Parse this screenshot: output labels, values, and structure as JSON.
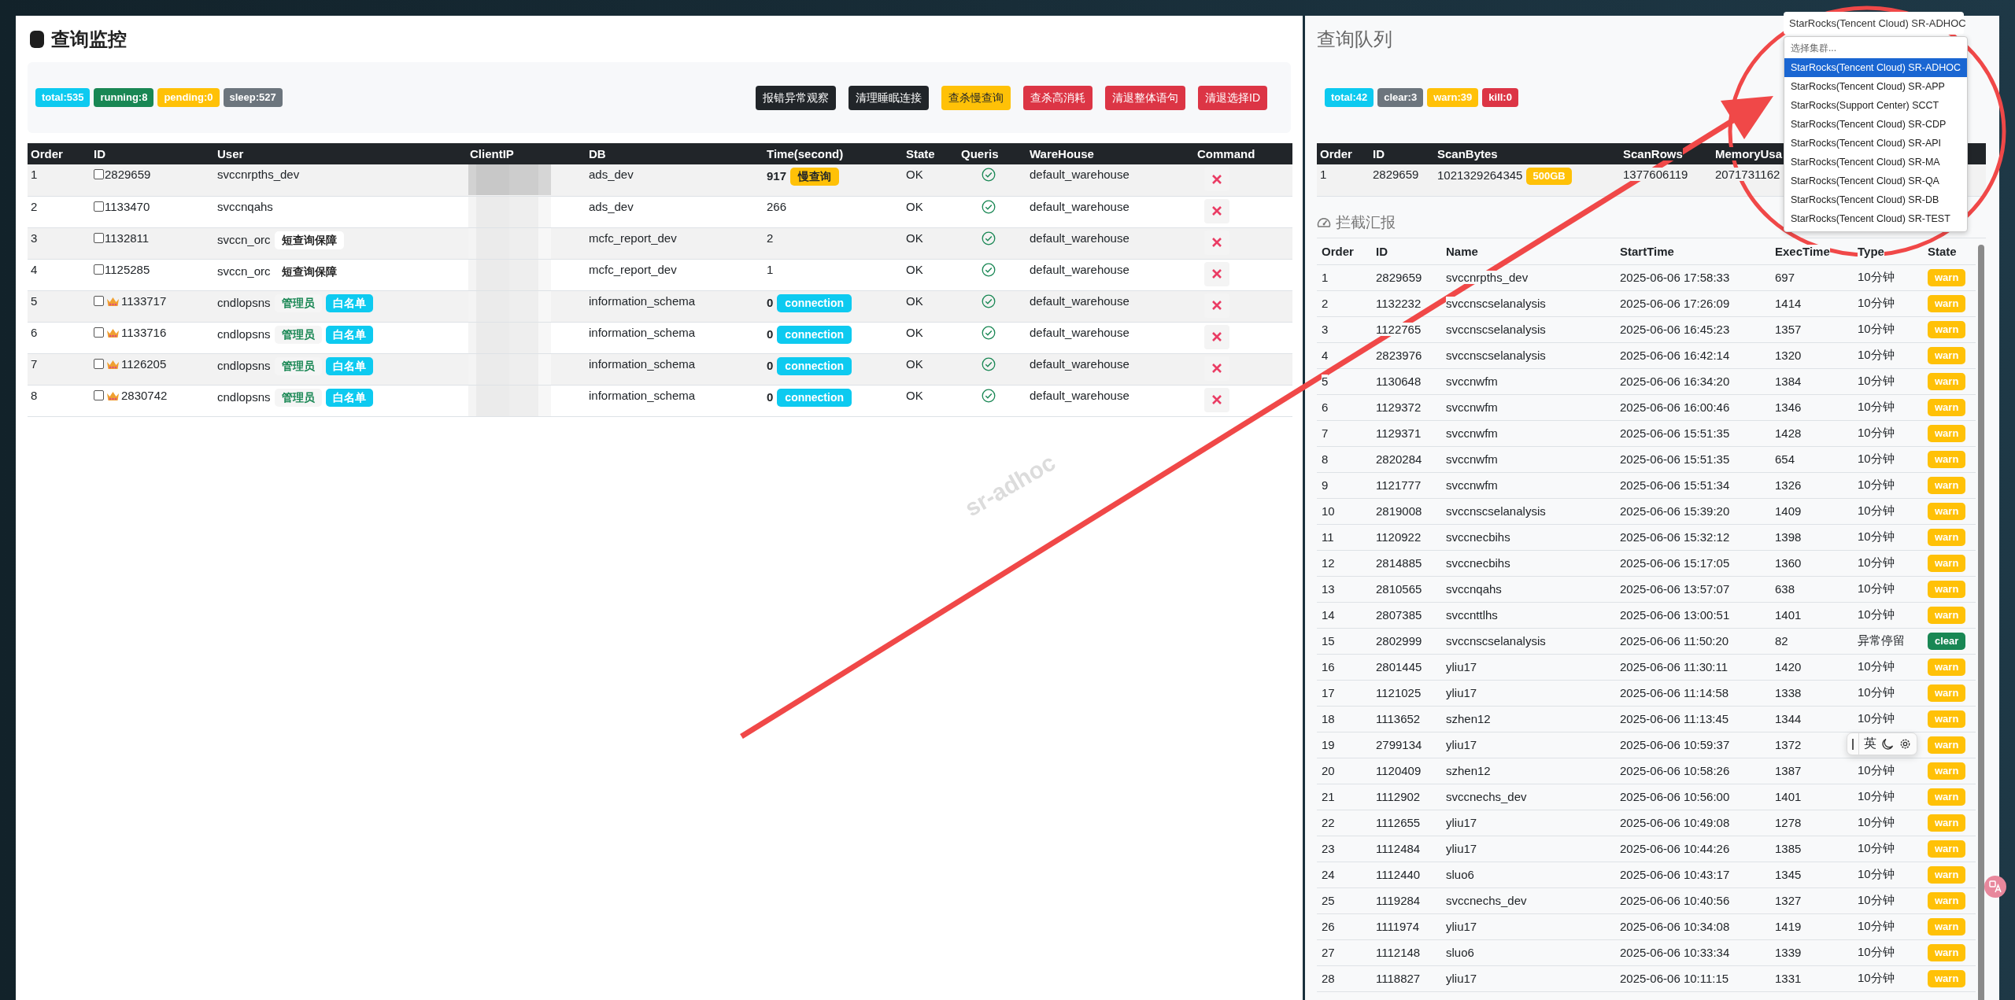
{
  "monitor": {
    "title": "查询监控",
    "stats": [
      {
        "label": "total:535",
        "color": "#0dcaf0"
      },
      {
        "label": "running:8",
        "color": "#198754"
      },
      {
        "label": "pending:0",
        "color": "#ffc107"
      },
      {
        "label": "sleep:527",
        "color": "#6c757d"
      }
    ],
    "buttons": [
      {
        "label": "报错异常观察",
        "kind": "dark"
      },
      {
        "label": "清理睡眠连接",
        "kind": "dark"
      },
      {
        "label": "查杀慢查询",
        "kind": "warning"
      },
      {
        "label": "查杀高消耗",
        "kind": "danger"
      },
      {
        "label": "清退整体语句",
        "kind": "danger"
      },
      {
        "label": "清退选择ID",
        "kind": "danger"
      }
    ],
    "watermark": "sr-adhoc",
    "table": {
      "columns": [
        "Order",
        "ID",
        "User",
        "ClientIP",
        "DB",
        "Time(second)",
        "State",
        "Queris",
        "WareHouse",
        "Command"
      ],
      "rows": [
        {
          "order": "1",
          "id": "2829659",
          "checked": false,
          "admin": false,
          "user": "svccnrpths_dev",
          "tags": [],
          "db": "ads_dev",
          "time": "917",
          "time_badge": {
            "label": "慢查询",
            "kind": "slow"
          },
          "state": "OK",
          "queris_ok": true,
          "warehouse": "default_warehouse"
        },
        {
          "order": "2",
          "id": "1133470",
          "checked": false,
          "admin": false,
          "user": "svccnqahs",
          "tags": [],
          "db": "ads_dev",
          "time": "266",
          "state": "OK",
          "queris_ok": true,
          "warehouse": "default_warehouse"
        },
        {
          "order": "3",
          "id": "1132811",
          "checked": false,
          "admin": false,
          "user": "svccn_orc",
          "tags": [
            {
              "label": "短查询保障",
              "kind": "plain"
            }
          ],
          "db": "mcfc_report_dev",
          "time": "2",
          "state": "OK",
          "queris_ok": true,
          "warehouse": "default_warehouse"
        },
        {
          "order": "4",
          "id": "1125285",
          "checked": false,
          "admin": false,
          "user": "svccn_orc",
          "tags": [
            {
              "label": "短查询保障",
              "kind": "plain"
            }
          ],
          "db": "mcfc_report_dev",
          "time": "1",
          "state": "OK",
          "queris_ok": true,
          "warehouse": "default_warehouse"
        },
        {
          "order": "5",
          "id": "1133717",
          "checked": false,
          "admin": true,
          "user": "cndlopsns",
          "tags": [
            {
              "label": "管理员",
              "kind": "admin"
            },
            {
              "label": "白名单",
              "kind": "whitelist"
            }
          ],
          "db": "information_schema",
          "time": "0",
          "time_badge": {
            "label": "connection",
            "kind": "connection"
          },
          "state": "OK",
          "queris_ok": true,
          "warehouse": "default_warehouse"
        },
        {
          "order": "6",
          "id": "1133716",
          "checked": false,
          "admin": true,
          "user": "cndlopsns",
          "tags": [
            {
              "label": "管理员",
              "kind": "admin"
            },
            {
              "label": "白名单",
              "kind": "whitelist"
            }
          ],
          "db": "information_schema",
          "time": "0",
          "time_badge": {
            "label": "connection",
            "kind": "connection"
          },
          "state": "OK",
          "queris_ok": true,
          "warehouse": "default_warehouse"
        },
        {
          "order": "7",
          "id": "1126205",
          "checked": false,
          "admin": true,
          "user": "cndlopsns",
          "tags": [
            {
              "label": "管理员",
              "kind": "admin"
            },
            {
              "label": "白名单",
              "kind": "whitelist"
            }
          ],
          "db": "information_schema",
          "time": "0",
          "time_badge": {
            "label": "connection",
            "kind": "connection"
          },
          "state": "OK",
          "queris_ok": true,
          "warehouse": "default_warehouse"
        },
        {
          "order": "8",
          "id": "2830742",
          "checked": false,
          "admin": true,
          "user": "cndlopsns",
          "tags": [
            {
              "label": "管理员",
              "kind": "admin"
            },
            {
              "label": "白名单",
              "kind": "whitelist"
            }
          ],
          "db": "information_schema",
          "time": "0",
          "time_badge": {
            "label": "connection",
            "kind": "connection"
          },
          "state": "OK",
          "queris_ok": true,
          "warehouse": "default_warehouse"
        }
      ]
    }
  },
  "queue": {
    "title": "查询队列",
    "stats": [
      {
        "label": "total:42",
        "color": "#0dcaf0"
      },
      {
        "label": "clear:3",
        "color": "#6c757d"
      },
      {
        "label": "warn:39",
        "color": "#ffc107"
      },
      {
        "label": "kill:0",
        "color": "#dc3545"
      }
    ],
    "table": {
      "columns": [
        "Order",
        "ID",
        "ScanBytes",
        "ScanRows",
        "MemoryUsa"
      ],
      "rows": [
        {
          "order": "1",
          "id": "2829659",
          "scan_bytes": "1021329264345",
          "scan_badge": "500GB",
          "scan_rows": "1377606119",
          "memory": "2071731162"
        }
      ]
    }
  },
  "cluster_select": {
    "value": "StarRocks(Tencent Cloud) SR-ADHOC",
    "search_placeholder": "选择集群...",
    "options": [
      {
        "label": "StarRocks(Tencent Cloud) SR-ADHOC",
        "selected": true
      },
      {
        "label": "StarRocks(Tencent Cloud) SR-APP",
        "selected": false
      },
      {
        "label": "StarRocks(Support Center) SCCT",
        "selected": false
      },
      {
        "label": "StarRocks(Tencent Cloud) SR-CDP",
        "selected": false
      },
      {
        "label": "StarRocks(Tencent Cloud) SR-API",
        "selected": false
      },
      {
        "label": "StarRocks(Tencent Cloud) SR-MA",
        "selected": false
      },
      {
        "label": "StarRocks(Tencent Cloud) SR-QA",
        "selected": false
      },
      {
        "label": "StarRocks(Tencent Cloud) SR-DB",
        "selected": false
      },
      {
        "label": "StarRocks(Tencent Cloud) SR-TEST",
        "selected": false
      }
    ]
  },
  "report": {
    "title": "拦截汇报",
    "columns": [
      "Order",
      "ID",
      "Name",
      "StartTime",
      "ExecTime",
      "Type",
      "State"
    ],
    "rows": [
      {
        "order": "1",
        "id": "2829659",
        "name": "svccnrpths_dev",
        "start": "2025-06-06 17:58:33",
        "exec": "697",
        "type": "10分钟",
        "state": {
          "label": "warn",
          "kind": "warn"
        }
      },
      {
        "order": "2",
        "id": "1132232",
        "name": "svccnscselanalysis",
        "start": "2025-06-06 17:26:09",
        "exec": "1414",
        "type": "10分钟",
        "state": {
          "label": "warn",
          "kind": "warn"
        }
      },
      {
        "order": "3",
        "id": "1122765",
        "name": "svccnscselanalysis",
        "start": "2025-06-06 16:45:23",
        "exec": "1357",
        "type": "10分钟",
        "state": {
          "label": "warn",
          "kind": "warn"
        }
      },
      {
        "order": "4",
        "id": "2823976",
        "name": "svccnscselanalysis",
        "start": "2025-06-06 16:42:14",
        "exec": "1320",
        "type": "10分钟",
        "state": {
          "label": "warn",
          "kind": "warn"
        }
      },
      {
        "order": "5",
        "id": "1130648",
        "name": "svccnwfm",
        "start": "2025-06-06 16:34:20",
        "exec": "1384",
        "type": "10分钟",
        "state": {
          "label": "warn",
          "kind": "warn"
        }
      },
      {
        "order": "6",
        "id": "1129372",
        "name": "svccnwfm",
        "start": "2025-06-06 16:00:46",
        "exec": "1346",
        "type": "10分钟",
        "state": {
          "label": "warn",
          "kind": "warn"
        }
      },
      {
        "order": "7",
        "id": "1129371",
        "name": "svccnwfm",
        "start": "2025-06-06 15:51:35",
        "exec": "1428",
        "type": "10分钟",
        "state": {
          "label": "warn",
          "kind": "warn"
        }
      },
      {
        "order": "8",
        "id": "2820284",
        "name": "svccnwfm",
        "start": "2025-06-06 15:51:35",
        "exec": "654",
        "type": "10分钟",
        "state": {
          "label": "warn",
          "kind": "warn"
        }
      },
      {
        "order": "9",
        "id": "1121777",
        "name": "svccnwfm",
        "start": "2025-06-06 15:51:34",
        "exec": "1326",
        "type": "10分钟",
        "state": {
          "label": "warn",
          "kind": "warn"
        }
      },
      {
        "order": "10",
        "id": "2819008",
        "name": "svccnscselanalysis",
        "start": "2025-06-06 15:39:20",
        "exec": "1409",
        "type": "10分钟",
        "state": {
          "label": "warn",
          "kind": "warn"
        }
      },
      {
        "order": "11",
        "id": "1120922",
        "name": "svccnecbihs",
        "start": "2025-06-06 15:32:12",
        "exec": "1398",
        "type": "10分钟",
        "state": {
          "label": "warn",
          "kind": "warn"
        }
      },
      {
        "order": "12",
        "id": "2814885",
        "name": "svccnecbihs",
        "start": "2025-06-06 15:17:05",
        "exec": "1360",
        "type": "10分钟",
        "state": {
          "label": "warn",
          "kind": "warn"
        }
      },
      {
        "order": "13",
        "id": "2810565",
        "name": "svccnqahs",
        "start": "2025-06-06 13:57:07",
        "exec": "638",
        "type": "10分钟",
        "state": {
          "label": "warn",
          "kind": "warn"
        }
      },
      {
        "order": "14",
        "id": "2807385",
        "name": "svccnttlhs",
        "start": "2025-06-06 13:00:51",
        "exec": "1401",
        "type": "10分钟",
        "state": {
          "label": "warn",
          "kind": "warn"
        }
      },
      {
        "order": "15",
        "id": "2802999",
        "name": "svccnscselanalysis",
        "start": "2025-06-06 11:50:20",
        "exec": "82",
        "type": "异常停留",
        "state": {
          "label": "clear",
          "kind": "clear"
        }
      },
      {
        "order": "16",
        "id": "2801445",
        "name": "yliu17",
        "start": "2025-06-06 11:30:11",
        "exec": "1420",
        "type": "10分钟",
        "state": {
          "label": "warn",
          "kind": "warn"
        }
      },
      {
        "order": "17",
        "id": "1121025",
        "name": "yliu17",
        "start": "2025-06-06 11:14:58",
        "exec": "1338",
        "type": "10分钟",
        "state": {
          "label": "warn",
          "kind": "warn"
        }
      },
      {
        "order": "18",
        "id": "1113652",
        "name": "szhen12",
        "start": "2025-06-06 11:13:45",
        "exec": "1344",
        "type": "10分钟",
        "state": {
          "label": "warn",
          "kind": "warn"
        }
      },
      {
        "order": "19",
        "id": "2799134",
        "name": "yliu17",
        "start": "2025-06-06 10:59:37",
        "exec": "1372",
        "state": {
          "label": "warn",
          "kind": "warn"
        }
      },
      {
        "order": "20",
        "id": "1120409",
        "name": "szhen12",
        "start": "2025-06-06 10:58:26",
        "exec": "1387",
        "type": "10分钟",
        "state": {
          "label": "warn",
          "kind": "warn"
        }
      },
      {
        "order": "21",
        "id": "1112902",
        "name": "svccnechs_dev",
        "start": "2025-06-06 10:56:00",
        "exec": "1401",
        "type": "10分钟",
        "state": {
          "label": "warn",
          "kind": "warn"
        }
      },
      {
        "order": "22",
        "id": "1112655",
        "name": "yliu17",
        "start": "2025-06-06 10:49:08",
        "exec": "1278",
        "type": "10分钟",
        "state": {
          "label": "warn",
          "kind": "warn"
        }
      },
      {
        "order": "23",
        "id": "1112484",
        "name": "yliu17",
        "start": "2025-06-06 10:44:26",
        "exec": "1385",
        "type": "10分钟",
        "state": {
          "label": "warn",
          "kind": "warn"
        }
      },
      {
        "order": "24",
        "id": "1112440",
        "name": "sluo6",
        "start": "2025-06-06 10:43:17",
        "exec": "1345",
        "type": "10分钟",
        "state": {
          "label": "warn",
          "kind": "warn"
        }
      },
      {
        "order": "25",
        "id": "1119284",
        "name": "svccnechs_dev",
        "start": "2025-06-06 10:40:56",
        "exec": "1327",
        "type": "10分钟",
        "state": {
          "label": "warn",
          "kind": "warn"
        }
      },
      {
        "order": "26",
        "id": "1111974",
        "name": "yliu17",
        "start": "2025-06-06 10:34:08",
        "exec": "1419",
        "type": "10分钟",
        "state": {
          "label": "warn",
          "kind": "warn"
        }
      },
      {
        "order": "27",
        "id": "1112148",
        "name": "sluo6",
        "start": "2025-06-06 10:33:34",
        "exec": "1339",
        "type": "10分钟",
        "state": {
          "label": "warn",
          "kind": "warn"
        }
      },
      {
        "order": "28",
        "id": "1118827",
        "name": "yliu17",
        "start": "2025-06-06 10:11:15",
        "exec": "1331",
        "type": "10分钟",
        "state": {
          "label": "warn",
          "kind": "warn"
        }
      }
    ]
  },
  "ime_toolbar": {
    "mode": "英"
  }
}
